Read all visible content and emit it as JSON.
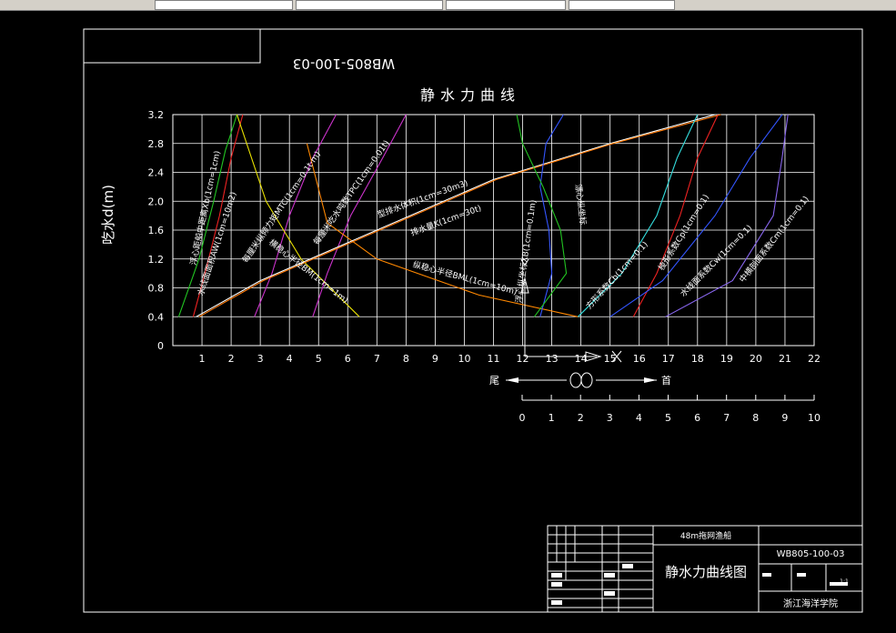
{
  "toolbar": {
    "fields": [
      "",
      "",
      "",
      "",
      ""
    ]
  },
  "drawing_number": "WB805-100-03",
  "scale_top": {
    "ticks": [
      "0",
      "1",
      "2",
      "3",
      "4",
      "5",
      "6",
      "7",
      "8",
      "9",
      "10",
      "11",
      "12",
      "13",
      "14",
      "15",
      "16",
      "17",
      "18",
      "19",
      "20",
      "21",
      "22"
    ]
  },
  "scale_bottom": {
    "ticks": [
      "0",
      "1",
      "2",
      "3",
      "4",
      "5",
      "6",
      "7",
      "8",
      "9",
      "10"
    ]
  },
  "direction": {
    "stern": "尾",
    "bow": "首"
  },
  "chart_data": {
    "type": "line",
    "title": "静水力曲线",
    "ylabel": "吃水d(m)",
    "xlabel": "",
    "xlim": [
      0,
      22
    ],
    "ylim": [
      0,
      3.2
    ],
    "y_ticks": [
      "0",
      "0.4",
      "0.8",
      "1.2",
      "1.6",
      "2.0",
      "2.4",
      "2.8",
      "3.2"
    ],
    "grid": true,
    "series": [
      {
        "name": "浮心距船中距离Xb(1cm=1cm)",
        "color": "#22c422",
        "x": [
          0.2,
          0.9,
          1.4,
          1.8,
          2.2
        ],
        "y": [
          0.4,
          1.2,
          2.0,
          2.7,
          3.2
        ]
      },
      {
        "name": "水线面面积AW(1cm=10m2)",
        "color": "#ee2222",
        "x": [
          0.7,
          1.1,
          1.6,
          2.0,
          2.4
        ],
        "y": [
          0.4,
          1.0,
          1.8,
          2.6,
          3.2
        ]
      },
      {
        "name": "每厘米纵倾力矩MTC(1cm=0.1t·m)",
        "color": "#cc33cc",
        "x": [
          2.8,
          3.4,
          4.0,
          4.8,
          5.6
        ],
        "y": [
          0.4,
          1.0,
          1.8,
          2.6,
          3.2
        ]
      },
      {
        "name": "每厘米吃水吨数TPC(1cm=0.01t)",
        "color": "#cc33cc",
        "x": [
          4.8,
          5.3,
          6.1,
          7.2,
          8.0
        ],
        "y": [
          0.4,
          1.0,
          1.8,
          2.6,
          3.2
        ]
      },
      {
        "name": "横稳心半径BM(1cm=1m)",
        "color": "#e8e000",
        "x": [
          6.4,
          5.4,
          4.4,
          3.2,
          2.2
        ],
        "y": [
          0.4,
          0.8,
          1.2,
          2.0,
          3.2
        ]
      },
      {
        "name": "纵稳心半径BML(1cm=10m)",
        "color": "#ff8800",
        "x": [
          13.9,
          10.5,
          7.0,
          5.3,
          4.6
        ],
        "y": [
          0.4,
          0.7,
          1.2,
          1.7,
          2.8
        ]
      },
      {
        "name": "型排水体积(1cm=30m3)",
        "color": "#ffffff",
        "x": [
          0.8,
          3.0,
          7.0,
          11.0,
          15.0,
          18.6
        ],
        "y": [
          0.4,
          0.9,
          1.6,
          2.3,
          2.8,
          3.2
        ]
      },
      {
        "name": "排水量K(1cm=30t)",
        "color": "#ff7a00",
        "x": [
          0.9,
          3.1,
          7.1,
          11.1,
          15.1,
          18.8
        ],
        "y": [
          0.4,
          0.9,
          1.6,
          2.3,
          2.8,
          3.2
        ]
      },
      {
        "name": "浮心纵坐标XB(1cm=0.1m)",
        "color": "#3355ff",
        "x": [
          12.6,
          13.0,
          12.9,
          12.6,
          12.8,
          13.4
        ],
        "y": [
          0.4,
          1.0,
          1.6,
          2.2,
          2.8,
          3.2
        ]
      },
      {
        "name": "漂心纵坐标XF(1cm=0.1m)",
        "color": "#22c422",
        "x": [
          12.4,
          13.5,
          13.3,
          12.7,
          12.0,
          11.8
        ],
        "y": [
          0.4,
          1.0,
          1.6,
          2.2,
          2.8,
          3.2
        ]
      },
      {
        "name": "方形系数Cb(1cm=0.1)",
        "color": "#33dddd",
        "x": [
          13.9,
          15.4,
          16.6,
          17.3,
          18.0
        ],
        "y": [
          0.4,
          1.0,
          1.8,
          2.6,
          3.2
        ]
      },
      {
        "name": "棱形系数Cp(1cm=0.1)",
        "color": "#ee2222",
        "x": [
          15.8,
          16.6,
          17.4,
          18.0,
          18.7
        ],
        "y": [
          0.4,
          1.0,
          1.8,
          2.6,
          3.2
        ]
      },
      {
        "name": "水线面系数Cw(1cm=0.1)",
        "color": "#3355ff",
        "x": [
          15.0,
          16.8,
          18.6,
          19.8,
          20.9
        ],
        "y": [
          0.4,
          0.9,
          1.8,
          2.6,
          3.2
        ]
      },
      {
        "name": "中横剖面系数Cm(1cm=0.1)",
        "color": "#8866ee",
        "x": [
          16.9,
          19.2,
          20.6,
          20.9,
          21.1
        ],
        "y": [
          0.4,
          0.9,
          1.8,
          2.6,
          3.2
        ]
      }
    ],
    "labels": [
      "浮心距船中距离Xb(1cm=1cm)",
      "水线面面积AW(1cm=10m2)",
      "每厘米纵倾力矩MTC(1cm=0.1t·m)",
      "每厘米吃水吨数TPC(1cm=0.01t)",
      "横稳心半径BM(1cm=1m)",
      "纵稳心半径BML(1cm=10m)",
      "型排水体积(1cm=30m3)",
      "排水量K(1cm=30t)",
      "浮心纵坐标XB(1cm=0.1m)",
      "漂心纵坐标",
      "方形系数Cb(1cm=0.1)",
      "棱形系数Cp(1cm=0.1)",
      "水线面系数Cw(1cm=0.1)",
      "中横剖面系数Cm(1cm=0.1)"
    ]
  },
  "title_block": {
    "ship_name": "48m拖网渔船",
    "drawing_title": "静水力曲线图",
    "drawing_no": "WB805-100-03",
    "institution": "浙江海洋学院",
    "scale": "1:1"
  }
}
